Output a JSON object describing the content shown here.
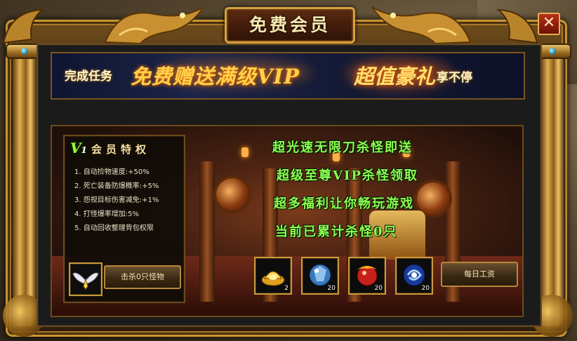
{
  "window": {
    "title": "免费会员",
    "close_label": "✕"
  },
  "banner": {
    "part1": "完成任务",
    "part2": "免费赠送满级VIP",
    "part3": "超值豪礼",
    "part4": "享不停"
  },
  "privileges": {
    "badge": "V",
    "badge_num": "1",
    "title": "会员特权",
    "items": [
      "1. 自动捡物速度:+50%",
      "2. 死亡装备防爆概率:+5%",
      "3. 怨视目标伤害减免:+1%",
      "4. 打怪爆率增加:5%",
      "5. 自动回收整理背包权限"
    ],
    "wings_icon": "angel-wings-icon",
    "kill_button_label": "击杀0只怪物"
  },
  "promo_lines": [
    "超光速无限刀杀怪即送",
    "超级至尊VIP杀怪领取",
    "超多福利让你畅玩游戏",
    "当前已累计杀怪0只"
  ],
  "rewards": [
    {
      "icon": "gold-ingot-icon",
      "qty": "2"
    },
    {
      "icon": "blue-crystal-orb-icon",
      "qty": "20"
    },
    {
      "icon": "red-dragon-orb-icon",
      "qty": "20"
    },
    {
      "icon": "blue-swirl-orb-icon",
      "qty": "20"
    }
  ],
  "daily_button_label": "每日工资",
  "colors": {
    "promo_green": "#8cff52",
    "gold_frame": "#c9952f",
    "banner_orange": "#ffd24a"
  }
}
